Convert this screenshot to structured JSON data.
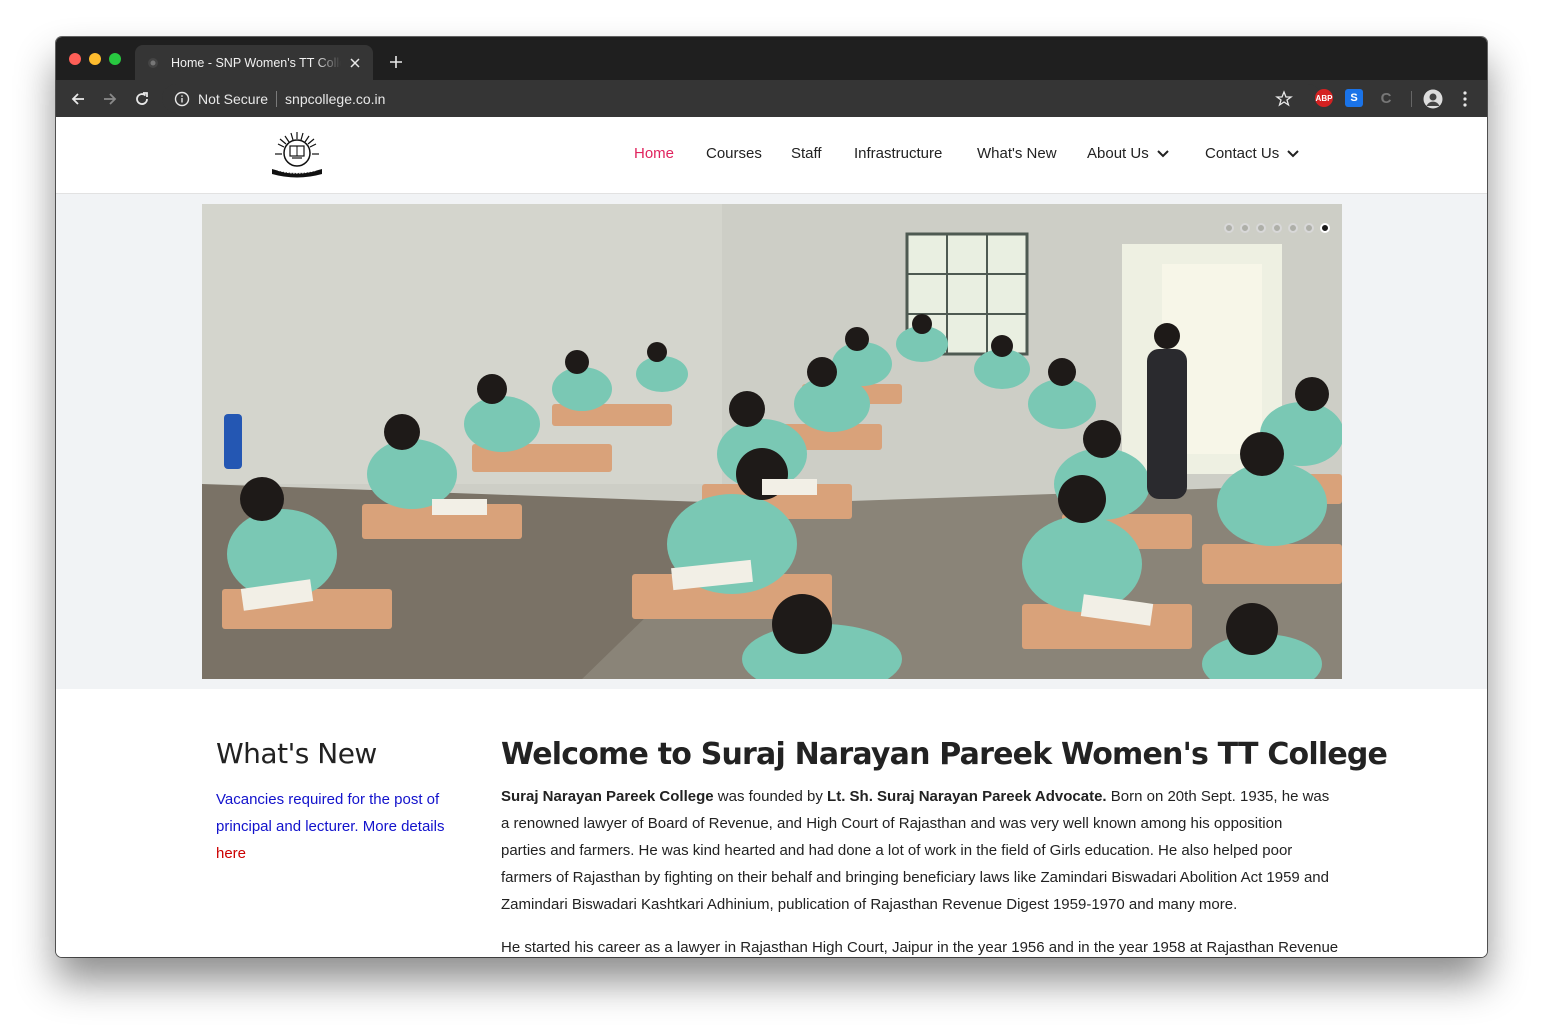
{
  "browser": {
    "tab_title": "Home - SNP Women's TT College",
    "security_label": "Not Secure",
    "url": "snpcollege.co.in",
    "extensions": [
      {
        "name": "adblock-plus",
        "label": "ABP",
        "color": "#d42121"
      },
      {
        "name": "s-extension",
        "label": "S",
        "color": "#1a73e8"
      },
      {
        "name": "c-extension",
        "label": "C",
        "color": "#555555"
      }
    ]
  },
  "nav": {
    "items": [
      {
        "label": "Home",
        "active": true
      },
      {
        "label": "Courses"
      },
      {
        "label": "Staff"
      },
      {
        "label": "Infrastructure"
      },
      {
        "label": "What's New"
      },
      {
        "label": "About Us",
        "dropdown": true
      },
      {
        "label": "Contact Us",
        "dropdown": true
      }
    ]
  },
  "slider": {
    "slide_count": 7,
    "active_index": 6,
    "image_description": "classroom-exam-students"
  },
  "sidebar": {
    "title": "What's New",
    "news_text": "Vacancies required for the post of principal and lecturer. More details",
    "news_link": "here"
  },
  "main": {
    "title": "Welcome to Suraj Narayan Pareek Women's TT College",
    "p1_bold1": "Suraj Narayan Pareek College",
    "p1_text1": " was founded by ",
    "p1_bold2": "Lt. Sh. Suraj Narayan Pareek Advocate.",
    "p1_text2": " Born on 20th Sept. 1935, he was a renowned lawyer of Board of Revenue, and High Court of Rajasthan and was very well known among his opposition parties and farmers. He was kind hearted and had done a lot of work in the field of Girls education. He also helped poor farmers of Rajasthan by fighting on their behalf and bringing beneficiary laws like Zamindari Biswadari Abolition Act 1959 and Zamindari Biswadari Kashtkari Adhinium, publication of Rajasthan Revenue Digest 1959-1970 and many more.",
    "p2": "He started his career as a lawyer in Rajasthan High Court, Jaipur in the year 1956 and in the year 1958 at Rajasthan Revenue"
  },
  "colors": {
    "nav_active": "#e0245e",
    "news_link": "#1212cc",
    "news_here": "#cc0000"
  }
}
